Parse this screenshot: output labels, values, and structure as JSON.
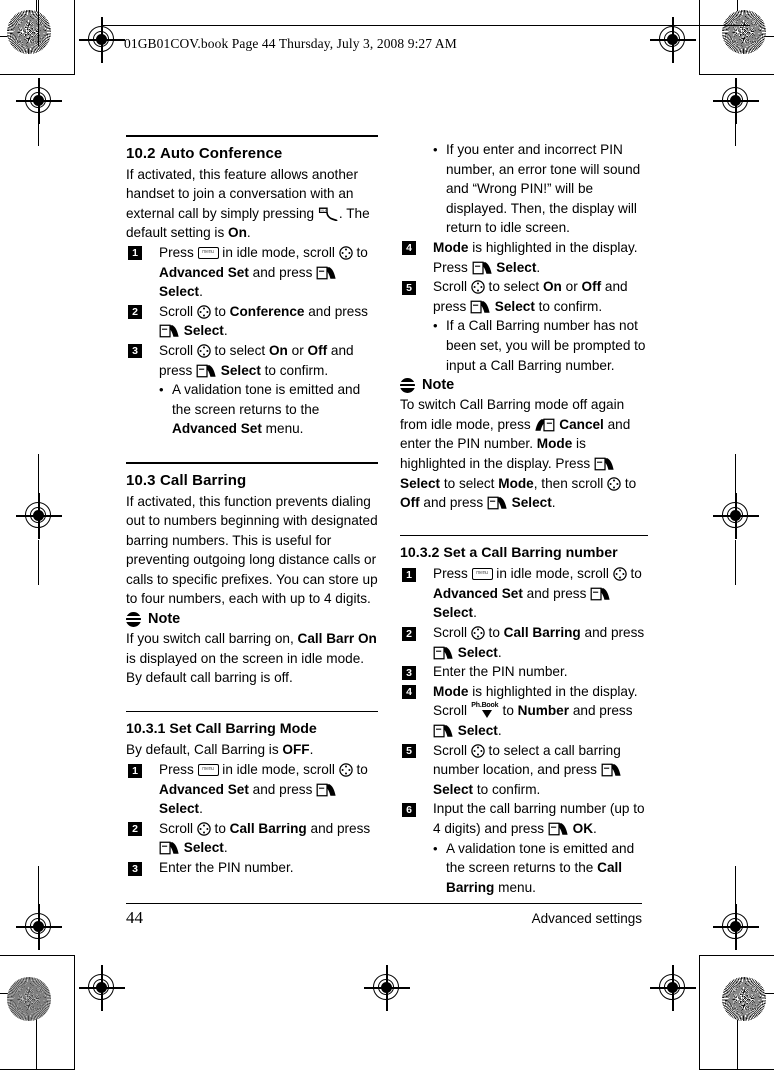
{
  "header": {
    "text": "01GB01COV.book  Page 44  Thursday, July 3, 2008  9:27 AM"
  },
  "footer": {
    "page_number": "44",
    "section_title": "Advanced settings"
  },
  "left_column": {
    "section_10_2": {
      "number": "10.2",
      "title": "Auto Conference",
      "intro_a": "If activated, this feature allows another handset to join a conversation with an external call by simply pressing ",
      "intro_b": ". The default setting is ",
      "intro_c": "On",
      "intro_d": ".",
      "steps": [
        {
          "num": "1",
          "parts": [
            {
              "t": "text",
              "v": "Press "
            },
            {
              "t": "icon",
              "v": "menu-key-icon"
            },
            {
              "t": "text",
              "v": " in idle mode, scroll "
            },
            {
              "t": "icon",
              "v": "navigation-key-icon"
            },
            {
              "t": "text",
              "v": " to "
            },
            {
              "t": "bold",
              "v": "Advanced Set"
            },
            {
              "t": "text",
              "v": " and press "
            },
            {
              "t": "icon",
              "v": "softkey-select-icon"
            },
            {
              "t": "bold",
              "v": " Select"
            },
            {
              "t": "text",
              "v": "."
            }
          ]
        },
        {
          "num": "2",
          "parts": [
            {
              "t": "text",
              "v": "Scroll "
            },
            {
              "t": "icon",
              "v": "navigation-key-icon"
            },
            {
              "t": "text",
              "v": " to "
            },
            {
              "t": "bold",
              "v": "Conference"
            },
            {
              "t": "text",
              "v": " and press "
            },
            {
              "t": "icon",
              "v": "softkey-select-icon"
            },
            {
              "t": "bold",
              "v": " Select"
            },
            {
              "t": "text",
              "v": "."
            }
          ]
        },
        {
          "num": "3",
          "parts": [
            {
              "t": "text",
              "v": "Scroll "
            },
            {
              "t": "icon",
              "v": "navigation-key-icon"
            },
            {
              "t": "text",
              "v": " to select "
            },
            {
              "t": "bold",
              "v": "On"
            },
            {
              "t": "text",
              "v": " or "
            },
            {
              "t": "bold",
              "v": "Off"
            },
            {
              "t": "text",
              "v": " and press "
            },
            {
              "t": "icon",
              "v": "softkey-select-icon"
            },
            {
              "t": "bold",
              "v": " Select"
            },
            {
              "t": "text",
              "v": " to confirm."
            }
          ],
          "bullets": [
            [
              {
                "t": "text",
                "v": "A validation tone is emitted and the screen returns to the "
              },
              {
                "t": "bold",
                "v": "Advanced Set"
              },
              {
                "t": "text",
                "v": " menu."
              }
            ]
          ]
        }
      ]
    },
    "section_10_3": {
      "number": "10.3",
      "title": "Call Barring",
      "intro": "If activated, this function prevents dialing out to numbers beginning with designated barring numbers. This is useful for preventing outgoing long distance calls or calls to specific prefixes. You can store up to four numbers, each with up to 4 digits.",
      "note": {
        "label": "Note",
        "parts": [
          {
            "t": "text",
            "v": "If you switch call barring on, "
          },
          {
            "t": "bold",
            "v": "Call Barr On"
          },
          {
            "t": "text",
            "v": " is displayed on the screen in idle mode. By default call barring is off."
          }
        ]
      }
    },
    "section_10_3_1": {
      "title": "10.3.1 Set Call Barring Mode",
      "intro_a": "By default, Call Barring is ",
      "intro_b": "OFF",
      "intro_c": ".",
      "steps": [
        {
          "num": "1",
          "parts": [
            {
              "t": "text",
              "v": "Press "
            },
            {
              "t": "icon",
              "v": "menu-key-icon"
            },
            {
              "t": "text",
              "v": " in idle mode, scroll "
            },
            {
              "t": "icon",
              "v": "navigation-key-icon"
            },
            {
              "t": "text",
              "v": " to "
            },
            {
              "t": "bold",
              "v": "Advanced Set"
            },
            {
              "t": "text",
              "v": " and press "
            },
            {
              "t": "icon",
              "v": "softkey-select-icon"
            },
            {
              "t": "bold",
              "v": " Select"
            },
            {
              "t": "text",
              "v": "."
            }
          ]
        },
        {
          "num": "2",
          "parts": [
            {
              "t": "text",
              "v": "Scroll "
            },
            {
              "t": "icon",
              "v": "navigation-key-icon"
            },
            {
              "t": "text",
              "v": " to "
            },
            {
              "t": "bold",
              "v": "Call Barring"
            },
            {
              "t": "text",
              "v": " and press "
            },
            {
              "t": "icon",
              "v": "softkey-select-icon"
            },
            {
              "t": "bold",
              "v": " Select"
            },
            {
              "t": "text",
              "v": "."
            }
          ]
        },
        {
          "num": "3",
          "parts": [
            {
              "t": "text",
              "v": "Enter the PIN number."
            }
          ]
        }
      ]
    }
  },
  "right_column": {
    "continued_bullets": [
      [
        {
          "t": "text",
          "v": "If you enter and incorrect PIN number, an error tone will sound and “Wrong PIN!” will be displayed. Then, the display will return to idle screen."
        }
      ]
    ],
    "steps": [
      {
        "num": "4",
        "parts": [
          {
            "t": "bold",
            "v": "Mode"
          },
          {
            "t": "text",
            "v": " is highlighted in the display. Press "
          },
          {
            "t": "icon",
            "v": "softkey-select-icon"
          },
          {
            "t": "bold",
            "v": " Select"
          },
          {
            "t": "text",
            "v": "."
          }
        ]
      },
      {
        "num": "5",
        "parts": [
          {
            "t": "text",
            "v": "Scroll "
          },
          {
            "t": "icon",
            "v": "navigation-key-icon"
          },
          {
            "t": "text",
            "v": " to select "
          },
          {
            "t": "bold",
            "v": "On"
          },
          {
            "t": "text",
            "v": " or "
          },
          {
            "t": "bold",
            "v": "Off"
          },
          {
            "t": "text",
            "v": " and press "
          },
          {
            "t": "icon",
            "v": "softkey-select-icon"
          },
          {
            "t": "bold",
            "v": " Select"
          },
          {
            "t": "text",
            "v": " to confirm."
          }
        ],
        "bullets": [
          [
            {
              "t": "text",
              "v": "If a Call Barring number has not been set, you will be prompted to input a Call Barring number."
            }
          ]
        ]
      }
    ],
    "note": {
      "label": "Note",
      "parts": [
        {
          "t": "text",
          "v": "To switch Call Barring mode off again from idle mode, press "
        },
        {
          "t": "icon",
          "v": "softkey-cancel-icon"
        },
        {
          "t": "bold",
          "v": " Cancel"
        },
        {
          "t": "text",
          "v": " and enter the PIN number. "
        },
        {
          "t": "bold",
          "v": "Mode"
        },
        {
          "t": "text",
          "v": " is highlighted in the display. Press "
        },
        {
          "t": "icon",
          "v": "softkey-select-icon"
        },
        {
          "t": "bold",
          "v": " Select"
        },
        {
          "t": "text",
          "v": " to select "
        },
        {
          "t": "bold",
          "v": "Mode"
        },
        {
          "t": "text",
          "v": ", then scroll "
        },
        {
          "t": "icon",
          "v": "navigation-key-icon"
        },
        {
          "t": "text",
          "v": " to "
        },
        {
          "t": "bold",
          "v": "Off"
        },
        {
          "t": "text",
          "v": " and press "
        },
        {
          "t": "icon",
          "v": "softkey-select-icon"
        },
        {
          "t": "bold",
          "v": " Select"
        },
        {
          "t": "text",
          "v": "."
        }
      ]
    },
    "section_10_3_2": {
      "title": "10.3.2 Set a Call Barring number",
      "steps": [
        {
          "num": "1",
          "parts": [
            {
              "t": "text",
              "v": "Press "
            },
            {
              "t": "icon",
              "v": "menu-key-icon"
            },
            {
              "t": "text",
              "v": " in idle mode, scroll "
            },
            {
              "t": "icon",
              "v": "navigation-key-icon"
            },
            {
              "t": "text",
              "v": " to "
            },
            {
              "t": "bold",
              "v": "Advanced Set"
            },
            {
              "t": "text",
              "v": " and press "
            },
            {
              "t": "icon",
              "v": "softkey-select-icon"
            },
            {
              "t": "bold",
              "v": " Select"
            },
            {
              "t": "text",
              "v": "."
            }
          ]
        },
        {
          "num": "2",
          "parts": [
            {
              "t": "text",
              "v": "Scroll "
            },
            {
              "t": "icon",
              "v": "navigation-key-icon"
            },
            {
              "t": "text",
              "v": " to "
            },
            {
              "t": "bold",
              "v": "Call Barring"
            },
            {
              "t": "text",
              "v": " and press "
            },
            {
              "t": "icon",
              "v": "softkey-select-icon"
            },
            {
              "t": "bold",
              "v": " Select"
            },
            {
              "t": "text",
              "v": "."
            }
          ]
        },
        {
          "num": "3",
          "parts": [
            {
              "t": "text",
              "v": "Enter the PIN number."
            }
          ]
        },
        {
          "num": "4",
          "parts": [
            {
              "t": "bold",
              "v": "Mode"
            },
            {
              "t": "text",
              "v": " is highlighted in the display. Scroll "
            },
            {
              "t": "icon",
              "v": "phonebook-down-key-icon"
            },
            {
              "t": "text",
              "v": " to "
            },
            {
              "t": "bold",
              "v": "Number"
            },
            {
              "t": "text",
              "v": " and press "
            },
            {
              "t": "icon",
              "v": "softkey-select-icon"
            },
            {
              "t": "bold",
              "v": " Select"
            },
            {
              "t": "text",
              "v": "."
            }
          ]
        },
        {
          "num": "5",
          "parts": [
            {
              "t": "text",
              "v": "Scroll "
            },
            {
              "t": "icon",
              "v": "navigation-key-icon"
            },
            {
              "t": "text",
              "v": " to select a call barring number location, and press "
            },
            {
              "t": "icon",
              "v": "softkey-select-icon"
            },
            {
              "t": "bold",
              "v": " Select"
            },
            {
              "t": "text",
              "v": " to confirm."
            }
          ]
        },
        {
          "num": "6",
          "parts": [
            {
              "t": "text",
              "v": "Input the call barring number (up to 4 digits) and press "
            },
            {
              "t": "icon",
              "v": "softkey-select-icon"
            },
            {
              "t": "bold",
              "v": " OK"
            },
            {
              "t": "text",
              "v": "."
            }
          ],
          "bullets": [
            [
              {
                "t": "text",
                "v": "A validation tone is emitted and the screen returns to the "
              },
              {
                "t": "bold",
                "v": "Call Barring"
              },
              {
                "t": "text",
                "v": " menu."
              }
            ]
          ]
        }
      ]
    }
  },
  "icons": {
    "menu_key_label": "menu",
    "phonebook_label": "Ph.Book"
  },
  "colors": {
    "ink": "#000000",
    "paper": "#ffffff"
  }
}
